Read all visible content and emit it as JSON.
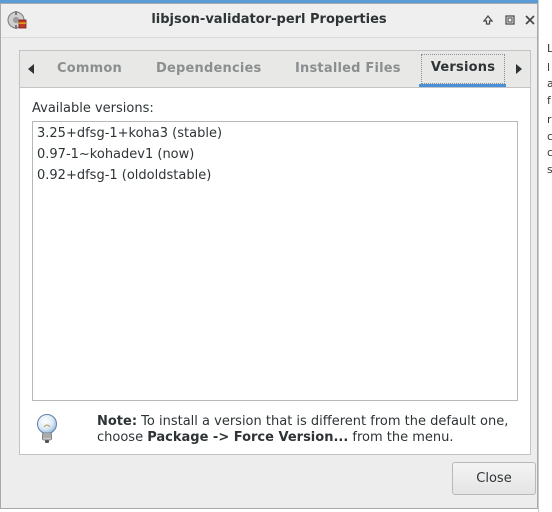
{
  "window": {
    "title": "libjson-validator-perl Properties"
  },
  "tabs": {
    "items": [
      "Common",
      "Dependencies",
      "Installed Files",
      "Versions"
    ],
    "active": "Versions"
  },
  "versions": {
    "label": "Available versions:",
    "items": [
      "3.25+dfsg-1+koha3 (stable)",
      "0.97-1~kohadev1 (now)",
      "0.92+dfsg-1 (oldoldstable)"
    ]
  },
  "note": {
    "prefix": "Note:",
    "text1": " To install a version that is different from the default one, choose ",
    "action": "Package -> Force Version...",
    "text2": " from the menu."
  },
  "buttons": {
    "close": "Close"
  },
  "background_chars": [
    "L",
    "l",
    "a",
    "f",
    "r",
    "c",
    "c",
    "s"
  ],
  "colors": {
    "accent": "#4a90d9"
  },
  "icons": {
    "app": "package-properties-icon",
    "note": "lightbulb-icon",
    "wm": [
      "maximize-icon",
      "restore-icon",
      "close-icon"
    ],
    "tabs": [
      "tab-scroll-left-icon",
      "tab-scroll-right-icon"
    ]
  }
}
